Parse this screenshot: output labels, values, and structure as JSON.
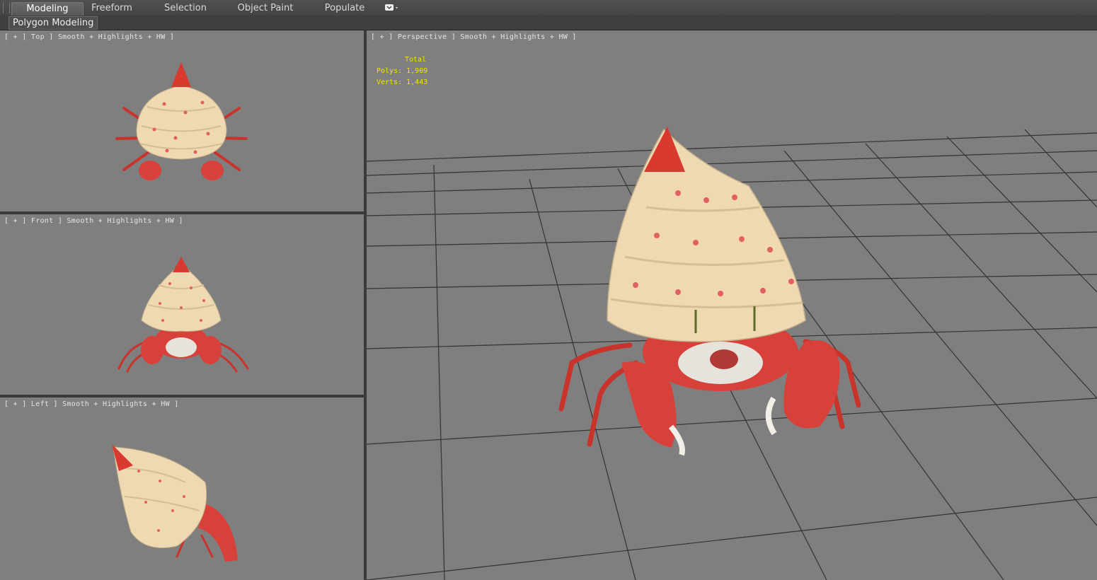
{
  "ribbon": {
    "tabs": [
      {
        "label": "Modeling",
        "active": true
      },
      {
        "label": "Freeform",
        "active": false
      },
      {
        "label": "Selection",
        "active": false
      },
      {
        "label": "Object Paint",
        "active": false
      },
      {
        "label": "Populate",
        "active": false
      }
    ],
    "menu_icon": "dropdown-icon"
  },
  "subbar": {
    "label": "Polygon Modeling"
  },
  "viewports": {
    "top": {
      "label": "[ + ] Top ] Smooth + Highlights + HW ]"
    },
    "front": {
      "label": "[ + ] Front ] Smooth + Highlights + HW ]"
    },
    "left": {
      "label": "[ + ] Left ] Smooth + Highlights + HW ]"
    },
    "perspective": {
      "label": "[ + ] Perspective ] Smooth + Highlights + HW ]",
      "stats": {
        "total": "Total",
        "polys": "Polys: 1,909",
        "verts": "Verts: 1,443"
      }
    }
  },
  "colors": {
    "viewport_bg": "#7f7f7f",
    "grid": "#333333",
    "shell": "#efd9b3",
    "crab_red": "#d8413a",
    "stats_yellow": "#f2e600"
  }
}
